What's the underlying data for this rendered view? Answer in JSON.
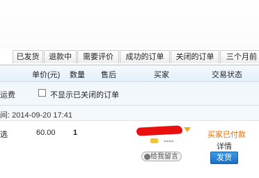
{
  "tabs": [
    "已发货",
    "退款中",
    "需要评价",
    "成功的订单",
    "关闭的订单",
    "三个月前"
  ],
  "columns": {
    "unit_price": "单价(元)",
    "quantity": "数量",
    "after_sale": "售后",
    "buyer": "买家",
    "status": "交易状态"
  },
  "filter": {
    "left_fragment": "运费",
    "hide_closed_label": "不显示已关闭的订单"
  },
  "order": {
    "time_label": "间: 2014-09-20 17:41",
    "item_fragment": "选",
    "price": "60.00",
    "quantity": "1",
    "buyer_extra": "----",
    "leave_message": "给我留言",
    "status": "买家已付款",
    "details": "详情",
    "ship_button": "发货"
  },
  "colors": {
    "status_orange": "#e0700c",
    "button_blue": "#1a6fc5",
    "redacted": "#e81010"
  }
}
